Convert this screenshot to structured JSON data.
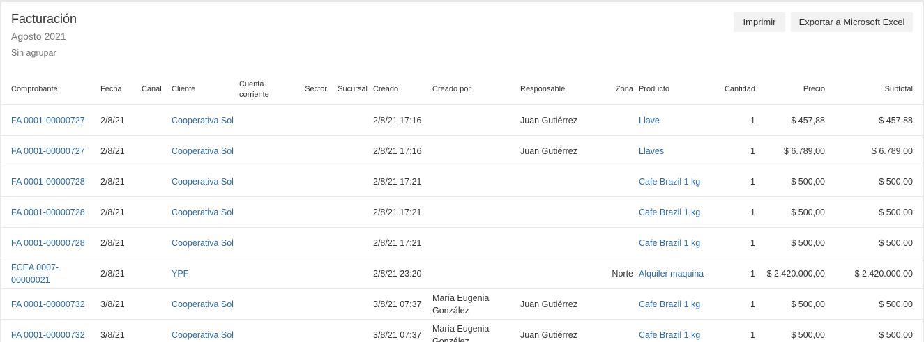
{
  "header": {
    "title": "Facturación",
    "period": "Agosto 2021",
    "grouping": "Sin agrupar"
  },
  "actions": {
    "print_label": "Imprimir",
    "export_label": "Exportar a Microsoft Excel"
  },
  "table": {
    "columns": [
      "Comprobante",
      "Fecha",
      "Canal",
      "Cliente",
      "Cuenta corriente",
      "Sector",
      "Sucursal",
      "Creado",
      "Creado por",
      "Responsable",
      "Zona",
      "Producto",
      "Cantidad",
      "Precio",
      "Subtotal"
    ],
    "rows": [
      {
        "comprobante": "FA 0001-00000727",
        "fecha": "2/8/21",
        "canal": "",
        "cliente": "Cooperativa Sol",
        "cuenta": "",
        "sector": "",
        "sucursal": "",
        "creado": "2/8/21 17:16",
        "creado_por": "",
        "responsable": "Juan Gutiérrez",
        "zona": "",
        "producto": "Llave",
        "cantidad": "1",
        "precio": "$ 457,88",
        "subtotal": "$ 457,88"
      },
      {
        "comprobante": "FA 0001-00000727",
        "fecha": "2/8/21",
        "canal": "",
        "cliente": "Cooperativa Sol",
        "cuenta": "",
        "sector": "",
        "sucursal": "",
        "creado": "2/8/21 17:16",
        "creado_por": "",
        "responsable": "Juan Gutiérrez",
        "zona": "",
        "producto": "Llaves",
        "cantidad": "1",
        "precio": "$ 6.789,00",
        "subtotal": "$ 6.789,00"
      },
      {
        "comprobante": "FA 0001-00000728",
        "fecha": "2/8/21",
        "canal": "",
        "cliente": "Cooperativa Sol",
        "cuenta": "",
        "sector": "",
        "sucursal": "",
        "creado": "2/8/21 17:21",
        "creado_por": "",
        "responsable": "",
        "zona": "",
        "producto": "Cafe Brazil 1 kg",
        "cantidad": "1",
        "precio": "$ 500,00",
        "subtotal": "$ 500,00"
      },
      {
        "comprobante": "FA 0001-00000728",
        "fecha": "2/8/21",
        "canal": "",
        "cliente": "Cooperativa Sol",
        "cuenta": "",
        "sector": "",
        "sucursal": "",
        "creado": "2/8/21 17:21",
        "creado_por": "",
        "responsable": "",
        "zona": "",
        "producto": "Cafe Brazil 1 kg",
        "cantidad": "1",
        "precio": "$ 500,00",
        "subtotal": "$ 500,00"
      },
      {
        "comprobante": "FA 0001-00000728",
        "fecha": "2/8/21",
        "canal": "",
        "cliente": "Cooperativa Sol",
        "cuenta": "",
        "sector": "",
        "sucursal": "",
        "creado": "2/8/21 17:21",
        "creado_por": "",
        "responsable": "",
        "zona": "",
        "producto": "Cafe Brazil 1 kg",
        "cantidad": "1",
        "precio": "$ 500,00",
        "subtotal": "$ 500,00"
      },
      {
        "comprobante": "FCEA 0007-00000021",
        "fecha": "2/8/21",
        "canal": "",
        "cliente": "YPF",
        "cuenta": "",
        "sector": "",
        "sucursal": "",
        "creado": "2/8/21 23:20",
        "creado_por": "",
        "responsable": "",
        "zona": "Norte",
        "producto": "Alquiler maquina",
        "cantidad": "1",
        "precio": "$ 2.420.000,00",
        "subtotal": "$ 2.420.000,00"
      },
      {
        "comprobante": "FA 0001-00000732",
        "fecha": "3/8/21",
        "canal": "",
        "cliente": "Cooperativa Sol",
        "cuenta": "",
        "sector": "",
        "sucursal": "",
        "creado": "3/8/21 07:37",
        "creado_por": "María Eugenia González",
        "responsable": "Juan Gutiérrez",
        "zona": "",
        "producto": "Cafe Brazil 1 kg",
        "cantidad": "1",
        "precio": "$ 500,00",
        "subtotal": "$ 500,00"
      },
      {
        "comprobante": "FA 0001-00000732",
        "fecha": "3/8/21",
        "canal": "",
        "cliente": "Cooperativa Sol",
        "cuenta": "",
        "sector": "",
        "sucursal": "",
        "creado": "3/8/21 07:37",
        "creado_por": "María Eugenia González",
        "responsable": "Juan Gutiérrez",
        "zona": "",
        "producto": "Cafe Brazil 1 kg",
        "cantidad": "1",
        "precio": "$ 500,00",
        "subtotal": "$ 500,00"
      }
    ]
  },
  "colors": {
    "link": "#2a6aa8",
    "text": "#333333",
    "muted": "#777777",
    "button_bg": "#f2f2f2"
  }
}
